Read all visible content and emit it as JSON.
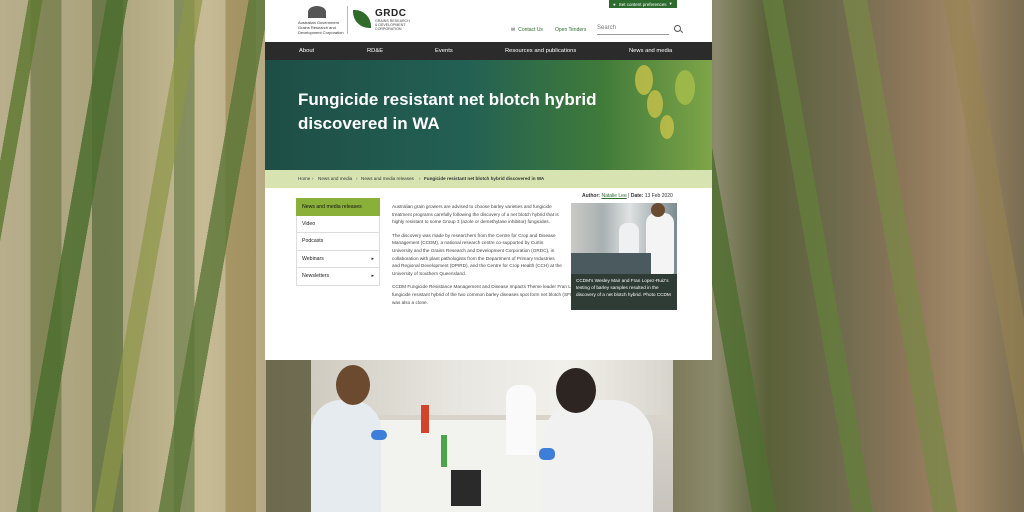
{
  "site": {
    "gov_logo": {
      "line1": "Australian Government",
      "line2": "Grains Research and",
      "line3": "Development Corporation"
    },
    "grdc_logo": {
      "name": "GRDC",
      "sub1": "GRAINS RESEARCH",
      "sub2": "& DEVELOPMENT",
      "sub3": "CORPORATION"
    },
    "preferences_button": "Set content preferences",
    "contact_label": "Contact Us",
    "open_tenders_label": "Open Tenders",
    "search_placeholder": "Search",
    "nav": [
      "About",
      "RD&E",
      "Events",
      "Resources and publications",
      "News and media"
    ],
    "hero_title": "Fungicide resistant net blotch hybrid discovered in WA",
    "breadcrumb": [
      "Home",
      "News and media",
      "News and media releases",
      "Fungicide resistant net blotch hybrid discovered in WA"
    ],
    "sidebar": [
      {
        "label": "News and media releases",
        "active": true
      },
      {
        "label": "Video"
      },
      {
        "label": "Podcasts"
      },
      {
        "label": "Webinars",
        "arrow": "▸"
      },
      {
        "label": "Newsletters",
        "arrow": "▸"
      }
    ],
    "author_label": "Author:",
    "author_name": "Natalie Lee",
    "date_label": "Date:",
    "date": "13 Feb 2020",
    "article": [
      "Australian grain growers are advised to choose barley varieties and fungicide treatment programs carefully following the discovery of a net blotch hybrid that is highly resistant to some Group 3 (azole or demethylase inhibitor) fungicides.",
      "The discovery was made by researchers from the Centre for Crop and Disease Management (CCDM), a national research centre co-supported by Curtin University and the Grains Research and Development Corporation (GRDC), in collaboration with plant pathologists from the Department of Primary Industries and Regional Development (DPIRD), and the Centre for Crop Health (CCH) at the University of Southern Queensland.",
      "CCDM Fungicide Resistance Management and Disease Impacts Theme leader Fran Lopez-Ruiz said not only had they discovered a fungicide resistant hybrid of the two common barley diseases spot form net blotch (SFNB) and net form net blotch (NFNB), the hybrid was also a clone."
    ],
    "photo_caption": "CCDM's Wesley Mair and Fran Lopez-Ruiz's testing of barley samples resulted in the discovery of a net blotch hybrid. Photo CCDM",
    "colors": {
      "nav": "#2b2b2b",
      "accent": "#8ab03a",
      "breadcrumb_bar": "#d7e4b2",
      "brand_green": "#2e6b2e"
    }
  }
}
